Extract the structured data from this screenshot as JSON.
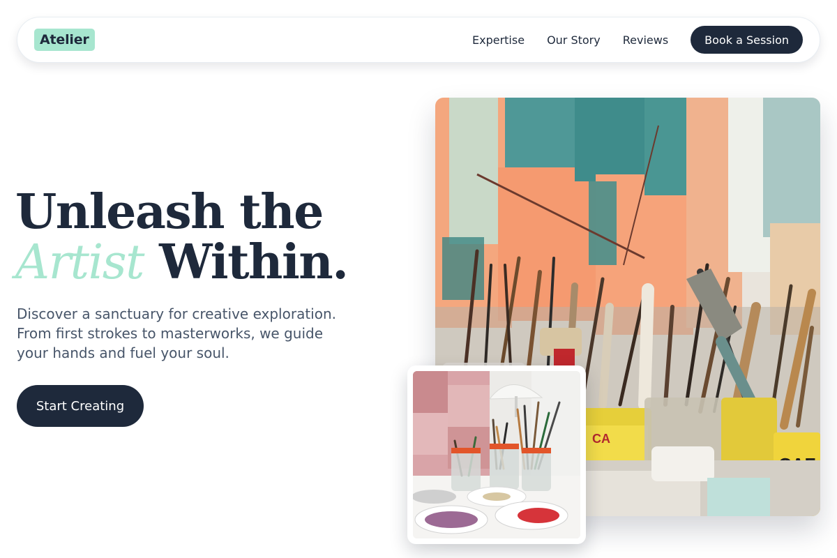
{
  "nav": {
    "logo": "Atelier",
    "links": [
      "Expertise",
      "Our Story",
      "Reviews"
    ],
    "cta": "Book a Session"
  },
  "hero": {
    "line1": "Unleash the",
    "accent_word": "Artist",
    "line2_rest": "Within.",
    "subtitle": "Discover a sanctuary for creative exploration. From first strokes to masterworks, we guide your hands and fuel your soul.",
    "cta": "Start Creating"
  },
  "colors": {
    "primary_dark": "#1e293b",
    "accent_mint": "#a7e6cf",
    "body_text": "#475569"
  }
}
